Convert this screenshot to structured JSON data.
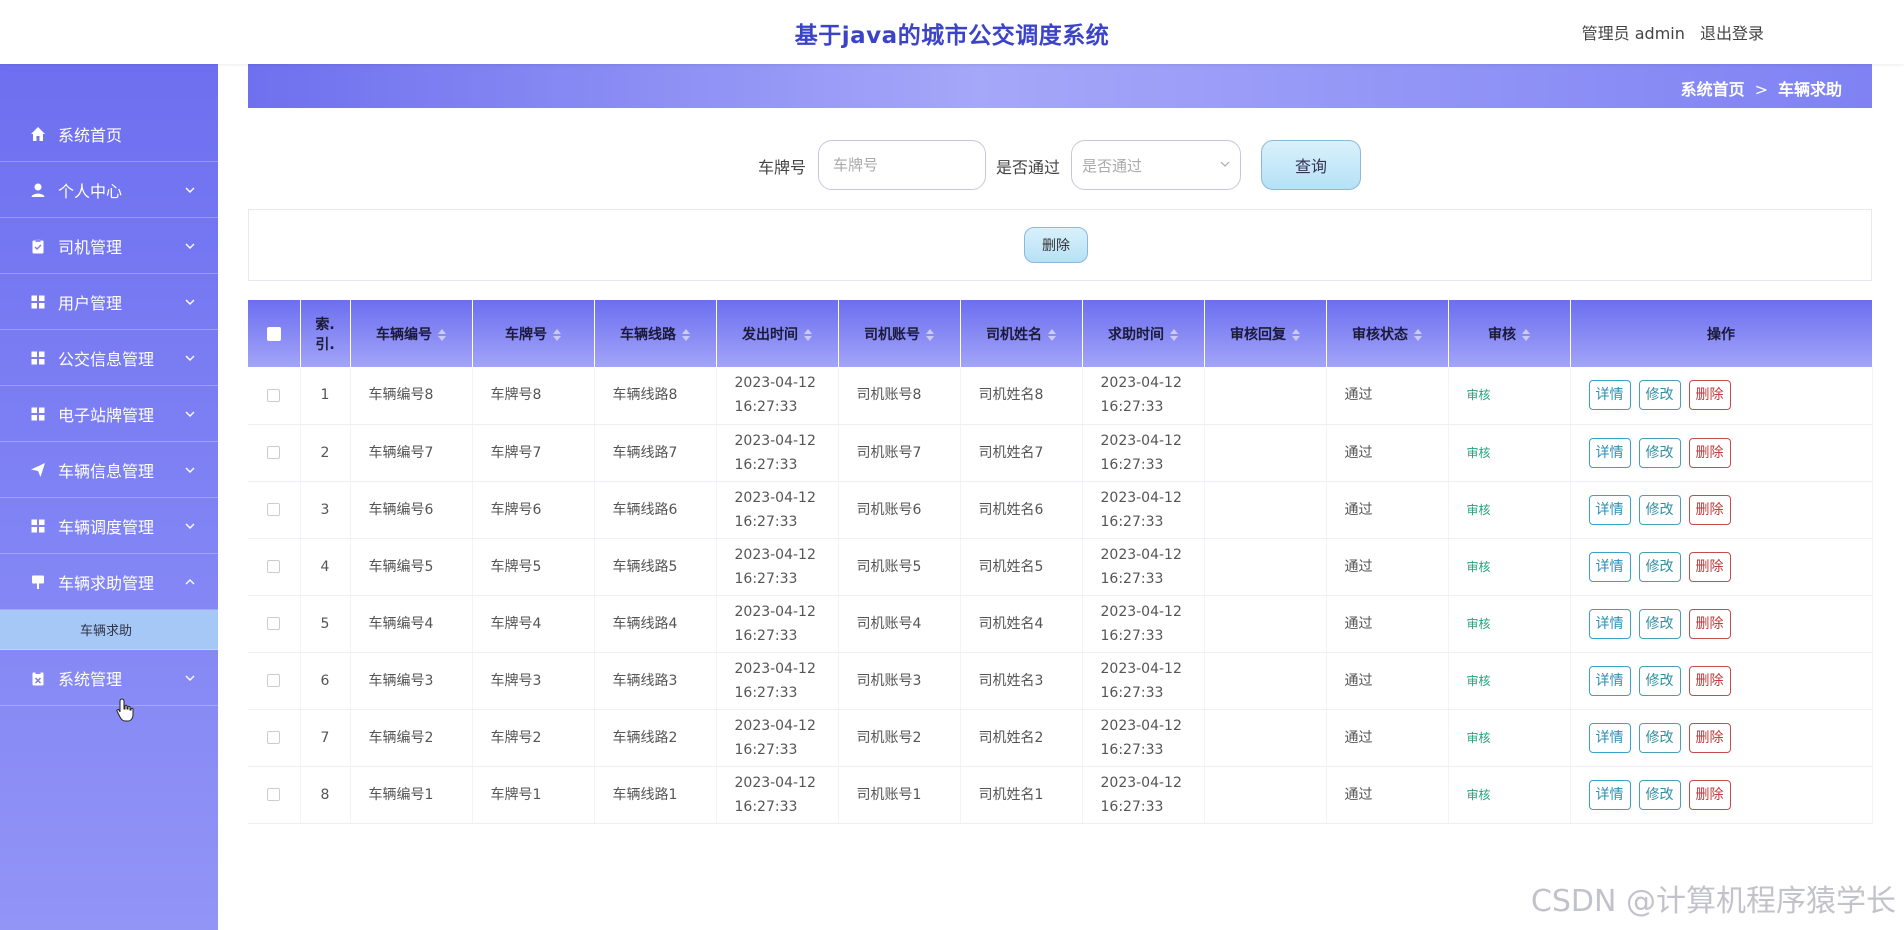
{
  "header": {
    "title": "基于java的城市公交调度系统",
    "user_label": "管理员 admin",
    "logout_label": "退出登录"
  },
  "sidebar": {
    "items": [
      {
        "label": "系统首页",
        "icon": "home-icon",
        "chevron": false
      },
      {
        "label": "个人中心",
        "icon": "user-icon",
        "chevron": true
      },
      {
        "label": "司机管理",
        "icon": "clipboard-icon",
        "chevron": true
      },
      {
        "label": "用户管理",
        "icon": "grid-icon",
        "chevron": true
      },
      {
        "label": "公交信息管理",
        "icon": "grid-icon",
        "chevron": true
      },
      {
        "label": "电子站牌管理",
        "icon": "grid-icon",
        "chevron": true
      },
      {
        "label": "车辆信息管理",
        "icon": "send-icon",
        "chevron": true
      },
      {
        "label": "车辆调度管理",
        "icon": "grid-icon",
        "chevron": true
      },
      {
        "label": "车辆求助管理",
        "icon": "sign-icon",
        "chevron": true,
        "expanded": true
      },
      {
        "label": "系统管理",
        "icon": "gear-clipboard-icon",
        "chevron": true
      }
    ],
    "sub_item": "车辆求助"
  },
  "breadcrumb": {
    "home": "系统首页",
    "separator": ">",
    "current": "车辆求助"
  },
  "search": {
    "plate_label": "车牌号",
    "plate_placeholder": "车牌号",
    "pass_label": "是否通过",
    "pass_placeholder": "是否通过",
    "query_button": "查询"
  },
  "actions": {
    "delete_button": "删除"
  },
  "table": {
    "columns": [
      "",
      "索引",
      "车辆编号",
      "车牌号",
      "车辆线路",
      "发出时间",
      "司机账号",
      "司机姓名",
      "求助时间",
      "审核回复",
      "审核状态",
      "审核",
      "操作"
    ],
    "index_header_line1": "索.",
    "index_header_line2": "引.",
    "rows": [
      {
        "index": "1",
        "vehicle_no": "车辆编号8",
        "plate": "车牌号8",
        "route": "车辆线路8",
        "sent_date": "2023-04-12",
        "sent_time": "16:27:33",
        "driver_account": "司机账号8",
        "driver_name": "司机姓名8",
        "help_date": "2023-04-12",
        "help_time": "16:27:33",
        "reply": "",
        "status": "通过",
        "audit": "审核"
      },
      {
        "index": "2",
        "vehicle_no": "车辆编号7",
        "plate": "车牌号7",
        "route": "车辆线路7",
        "sent_date": "2023-04-12",
        "sent_time": "16:27:33",
        "driver_account": "司机账号7",
        "driver_name": "司机姓名7",
        "help_date": "2023-04-12",
        "help_time": "16:27:33",
        "reply": "",
        "status": "通过",
        "audit": "审核"
      },
      {
        "index": "3",
        "vehicle_no": "车辆编号6",
        "plate": "车牌号6",
        "route": "车辆线路6",
        "sent_date": "2023-04-12",
        "sent_time": "16:27:33",
        "driver_account": "司机账号6",
        "driver_name": "司机姓名6",
        "help_date": "2023-04-12",
        "help_time": "16:27:33",
        "reply": "",
        "status": "通过",
        "audit": "审核"
      },
      {
        "index": "4",
        "vehicle_no": "车辆编号5",
        "plate": "车牌号5",
        "route": "车辆线路5",
        "sent_date": "2023-04-12",
        "sent_time": "16:27:33",
        "driver_account": "司机账号5",
        "driver_name": "司机姓名5",
        "help_date": "2023-04-12",
        "help_time": "16:27:33",
        "reply": "",
        "status": "通过",
        "audit": "审核"
      },
      {
        "index": "5",
        "vehicle_no": "车辆编号4",
        "plate": "车牌号4",
        "route": "车辆线路4",
        "sent_date": "2023-04-12",
        "sent_time": "16:27:33",
        "driver_account": "司机账号4",
        "driver_name": "司机姓名4",
        "help_date": "2023-04-12",
        "help_time": "16:27:33",
        "reply": "",
        "status": "通过",
        "audit": "审核"
      },
      {
        "index": "6",
        "vehicle_no": "车辆编号3",
        "plate": "车牌号3",
        "route": "车辆线路3",
        "sent_date": "2023-04-12",
        "sent_time": "16:27:33",
        "driver_account": "司机账号3",
        "driver_name": "司机姓名3",
        "help_date": "2023-04-12",
        "help_time": "16:27:33",
        "reply": "",
        "status": "通过",
        "audit": "审核"
      },
      {
        "index": "7",
        "vehicle_no": "车辆编号2",
        "plate": "车牌号2",
        "route": "车辆线路2",
        "sent_date": "2023-04-12",
        "sent_time": "16:27:33",
        "driver_account": "司机账号2",
        "driver_name": "司机姓名2",
        "help_date": "2023-04-12",
        "help_time": "16:27:33",
        "reply": "",
        "status": "通过",
        "audit": "审核"
      },
      {
        "index": "8",
        "vehicle_no": "车辆编号1",
        "plate": "车牌号1",
        "route": "车辆线路1",
        "sent_date": "2023-04-12",
        "sent_time": "16:27:33",
        "driver_account": "司机账号1",
        "driver_name": "司机姓名1",
        "help_date": "2023-04-12",
        "help_time": "16:27:33",
        "reply": "",
        "status": "通过",
        "audit": "审核"
      }
    ],
    "row_actions": {
      "detail": "详情",
      "edit": "修改",
      "delete": "删除"
    }
  },
  "watermark": "CSDN @计算机程序猿学长",
  "colors": {
    "title": "#3b44c8",
    "sidebar_top": "#6d6ff0",
    "sidebar_bottom": "#9294f6",
    "sub_item_bg": "#a5c8f7",
    "audit_link": "#24a37b",
    "delete": "#c23a3a"
  }
}
